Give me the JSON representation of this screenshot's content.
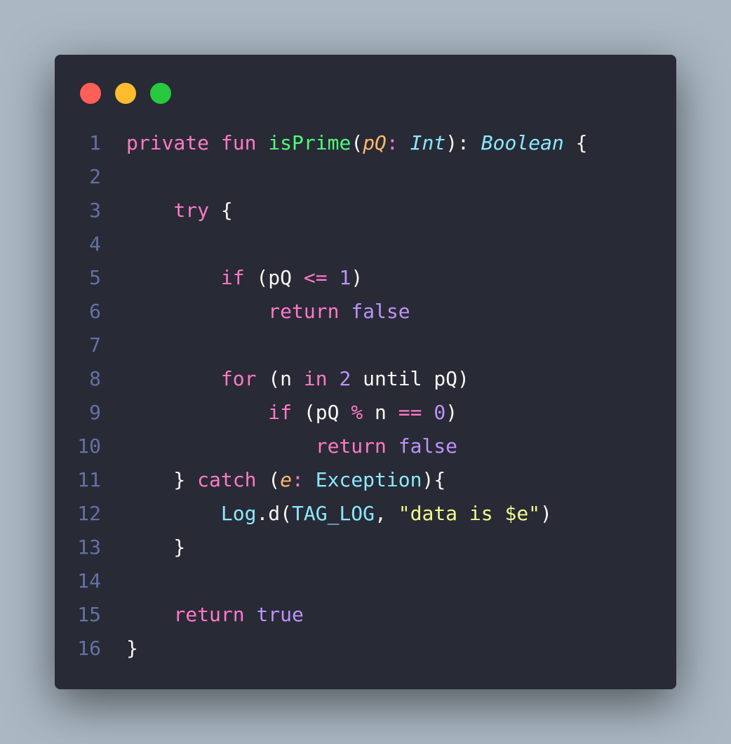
{
  "window": {
    "controls": [
      {
        "name": "close",
        "color": "#ff5f56"
      },
      {
        "name": "minimize",
        "color": "#ffbd2e"
      },
      {
        "name": "maximize",
        "color": "#27c93f"
      }
    ]
  },
  "colors": {
    "background": "#abb8c3",
    "editor_bg": "#282a36",
    "line_number": "#6272a4",
    "plain": "#f8f8f2",
    "keyword": "#ff79c6",
    "function": "#50fa7b",
    "type": "#8be9fd",
    "param": "#ffb86c",
    "constant": "#bd93f9",
    "string": "#f1fa8c"
  },
  "code_lines": [
    {
      "number": "1",
      "tokens": [
        {
          "text": "private",
          "kind": "keyword"
        },
        {
          "text": " ",
          "kind": "plain"
        },
        {
          "text": "fun",
          "kind": "keyword"
        },
        {
          "text": " ",
          "kind": "plain"
        },
        {
          "text": "isPrime",
          "kind": "function"
        },
        {
          "text": "(",
          "kind": "plain"
        },
        {
          "text": "pQ",
          "kind": "param_italic"
        },
        {
          "text": ": ",
          "kind": "keyword"
        },
        {
          "text": "Int",
          "kind": "type_italic"
        },
        {
          "text": "): ",
          "kind": "plain"
        },
        {
          "text": "Boolean",
          "kind": "type_italic"
        },
        {
          "text": " {",
          "kind": "plain"
        }
      ]
    },
    {
      "number": "2",
      "tokens": []
    },
    {
      "number": "3",
      "tokens": [
        {
          "text": "    ",
          "kind": "plain"
        },
        {
          "text": "try",
          "kind": "keyword"
        },
        {
          "text": " {",
          "kind": "plain"
        }
      ]
    },
    {
      "number": "4",
      "tokens": []
    },
    {
      "number": "5",
      "tokens": [
        {
          "text": "        ",
          "kind": "plain"
        },
        {
          "text": "if",
          "kind": "keyword"
        },
        {
          "text": " (pQ ",
          "kind": "plain"
        },
        {
          "text": "<=",
          "kind": "keyword"
        },
        {
          "text": " ",
          "kind": "plain"
        },
        {
          "text": "1",
          "kind": "constant"
        },
        {
          "text": ")",
          "kind": "plain"
        }
      ]
    },
    {
      "number": "6",
      "tokens": [
        {
          "text": "            ",
          "kind": "plain"
        },
        {
          "text": "return",
          "kind": "keyword"
        },
        {
          "text": " ",
          "kind": "plain"
        },
        {
          "text": "false",
          "kind": "constant"
        }
      ]
    },
    {
      "number": "7",
      "tokens": []
    },
    {
      "number": "8",
      "tokens": [
        {
          "text": "        ",
          "kind": "plain"
        },
        {
          "text": "for",
          "kind": "keyword"
        },
        {
          "text": " (n ",
          "kind": "plain"
        },
        {
          "text": "in",
          "kind": "keyword"
        },
        {
          "text": " ",
          "kind": "plain"
        },
        {
          "text": "2",
          "kind": "constant"
        },
        {
          "text": " until pQ)",
          "kind": "plain"
        }
      ]
    },
    {
      "number": "9",
      "tokens": [
        {
          "text": "            ",
          "kind": "plain"
        },
        {
          "text": "if",
          "kind": "keyword"
        },
        {
          "text": " (pQ ",
          "kind": "plain"
        },
        {
          "text": "%",
          "kind": "keyword"
        },
        {
          "text": " n ",
          "kind": "plain"
        },
        {
          "text": "==",
          "kind": "keyword"
        },
        {
          "text": " ",
          "kind": "plain"
        },
        {
          "text": "0",
          "kind": "constant"
        },
        {
          "text": ")",
          "kind": "plain"
        }
      ]
    },
    {
      "number": "10",
      "tokens": [
        {
          "text": "                ",
          "kind": "plain"
        },
        {
          "text": "return",
          "kind": "keyword"
        },
        {
          "text": " ",
          "kind": "plain"
        },
        {
          "text": "false",
          "kind": "constant"
        }
      ]
    },
    {
      "number": "11",
      "tokens": [
        {
          "text": "    } ",
          "kind": "plain"
        },
        {
          "text": "catch",
          "kind": "keyword"
        },
        {
          "text": " (",
          "kind": "plain"
        },
        {
          "text": "e",
          "kind": "param_italic"
        },
        {
          "text": ": ",
          "kind": "keyword"
        },
        {
          "text": "Exception",
          "kind": "type"
        },
        {
          "text": "){",
          "kind": "plain"
        }
      ]
    },
    {
      "number": "12",
      "tokens": [
        {
          "text": "        ",
          "kind": "plain"
        },
        {
          "text": "Log",
          "kind": "type"
        },
        {
          "text": ".d(",
          "kind": "plain"
        },
        {
          "text": "TAG_LOG",
          "kind": "type"
        },
        {
          "text": ", ",
          "kind": "plain"
        },
        {
          "text": "\"data is $e\"",
          "kind": "string"
        },
        {
          "text": ")",
          "kind": "plain"
        }
      ]
    },
    {
      "number": "13",
      "tokens": [
        {
          "text": "    }",
          "kind": "plain"
        }
      ]
    },
    {
      "number": "14",
      "tokens": []
    },
    {
      "number": "15",
      "tokens": [
        {
          "text": "    ",
          "kind": "plain"
        },
        {
          "text": "return",
          "kind": "keyword"
        },
        {
          "text": " ",
          "kind": "plain"
        },
        {
          "text": "true",
          "kind": "constant"
        }
      ]
    },
    {
      "number": "16",
      "tokens": [
        {
          "text": "}",
          "kind": "plain"
        }
      ]
    }
  ]
}
